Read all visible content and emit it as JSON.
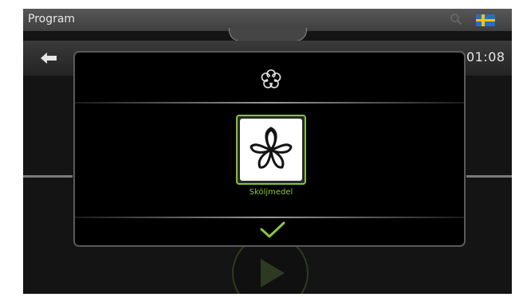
{
  "header": {
    "title": "Program"
  },
  "status": {
    "time": "01:08"
  },
  "dialog": {
    "option_label": "Sköljmedel"
  },
  "icons": {
    "search": "search-icon",
    "flag": "swedish-flag-icon",
    "back": "back-arrow-icon",
    "rinse_aid": "rinse-aid-flower-icon",
    "confirm": "checkmark-icon",
    "play": "play-icon"
  },
  "colors": {
    "accent": "#8cc63f",
    "flag_blue": "#2c6cbf",
    "flag_yellow": "#f4c400"
  }
}
